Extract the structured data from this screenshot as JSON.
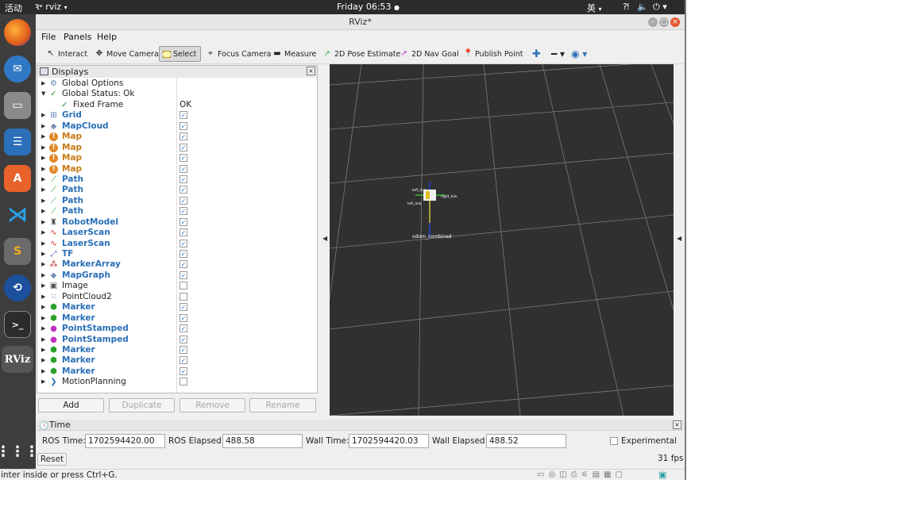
{
  "topbar": {
    "activities": "活动",
    "app_name": "rviz",
    "clock": "Friday 06:53",
    "input_method": "英"
  },
  "window": {
    "title": "RViz*"
  },
  "menu": {
    "file": "File",
    "panels": "Panels",
    "help": "Help"
  },
  "toolbar": {
    "interact": "Interact",
    "move_camera": "Move Camera",
    "select": "Select",
    "focus_camera": "Focus Camera",
    "measure": "Measure",
    "pose_estimate": "2D Pose Estimate",
    "nav_goal": "2D Nav Goal",
    "publish_point": "Publish Point"
  },
  "displays": {
    "title": "Displays",
    "items": [
      {
        "label": "Global Options",
        "icon": "gear-icon",
        "style": "normal",
        "check": null,
        "expanded": false,
        "indent": 0
      },
      {
        "label": "Global Status: Ok",
        "icon": "check-icon",
        "style": "normal",
        "check": null,
        "expanded": true,
        "indent": 0
      },
      {
        "label": "Fixed Frame",
        "icon": "check-icon",
        "style": "normal",
        "value": "OK",
        "check": null,
        "indent": 1
      },
      {
        "label": "Grid",
        "icon": "grid-icon",
        "style": "bold",
        "check": true
      },
      {
        "label": "MapCloud",
        "icon": "diamond-icon",
        "style": "bold",
        "check": true
      },
      {
        "label": "Map",
        "icon": "warning-icon",
        "style": "warn",
        "check": true
      },
      {
        "label": "Map",
        "icon": "warning-icon",
        "style": "warn",
        "check": true
      },
      {
        "label": "Map",
        "icon": "warning-icon",
        "style": "warn",
        "check": true
      },
      {
        "label": "Map",
        "icon": "warning-icon",
        "style": "warn",
        "check": true
      },
      {
        "label": "Path",
        "icon": "path-icon",
        "style": "bold",
        "check": true
      },
      {
        "label": "Path",
        "icon": "path-icon",
        "style": "bold",
        "check": true
      },
      {
        "label": "Path",
        "icon": "path-icon",
        "style": "bold",
        "check": true
      },
      {
        "label": "Path",
        "icon": "path-icon",
        "style": "bold",
        "check": true
      },
      {
        "label": "RobotModel",
        "icon": "robot-icon",
        "style": "bold",
        "check": true
      },
      {
        "label": "LaserScan",
        "icon": "laser-icon",
        "style": "bold",
        "check": true
      },
      {
        "label": "LaserScan",
        "icon": "laser-icon",
        "style": "bold",
        "check": true
      },
      {
        "label": "TF",
        "icon": "tf-icon",
        "style": "bold",
        "check": true
      },
      {
        "label": "MarkerArray",
        "icon": "marker-array-icon",
        "style": "bold",
        "check": true
      },
      {
        "label": "MapGraph",
        "icon": "diamond-icon",
        "style": "bold",
        "check": true
      },
      {
        "label": "Image",
        "icon": "image-icon",
        "style": "normal",
        "check": false
      },
      {
        "label": "PointCloud2",
        "icon": "pointcloud-icon",
        "style": "normal",
        "check": false
      },
      {
        "label": "Marker",
        "icon": "cube-icon",
        "style": "bold",
        "check": true
      },
      {
        "label": "Marker",
        "icon": "cube-icon",
        "style": "bold",
        "check": true
      },
      {
        "label": "PointStamped",
        "icon": "point-icon",
        "style": "bold",
        "check": true
      },
      {
        "label": "PointStamped",
        "icon": "point-icon",
        "style": "bold",
        "check": true
      },
      {
        "label": "Marker",
        "icon": "cube-icon",
        "style": "bold",
        "check": true
      },
      {
        "label": "Marker",
        "icon": "cube-icon",
        "style": "bold",
        "check": true
      },
      {
        "label": "Marker",
        "icon": "cube-icon",
        "style": "bold",
        "check": true
      },
      {
        "label": "MotionPlanning",
        "icon": "motion-icon",
        "style": "normal",
        "check": false
      }
    ],
    "buttons": {
      "add": "Add",
      "duplicate": "Duplicate",
      "remove": "Remove",
      "rename": "Rename"
    }
  },
  "view": {
    "frame_label": "odom_combined",
    "robot_labels": [
      "left_link",
      "right_link",
      "left_link"
    ]
  },
  "time": {
    "title": "Time",
    "ros_time_label": "ROS Time:",
    "ros_time": "1702594420.00",
    "ros_elapsed_label": "ROS Elapsed:",
    "ros_elapsed": "488.58",
    "wall_time_label": "Wall Time:",
    "wall_time": "1702594420.03",
    "wall_elapsed_label": "Wall Elapsed:",
    "wall_elapsed": "488.52",
    "experimental": "Experimental",
    "reset": "Reset",
    "fps": "31 fps"
  },
  "status": {
    "message": "inter inside or press Ctrl+G."
  },
  "colors": {
    "accent_blue": "#2a6fb8",
    "warn_orange": "#c87a12",
    "view_bg": "#303030"
  }
}
